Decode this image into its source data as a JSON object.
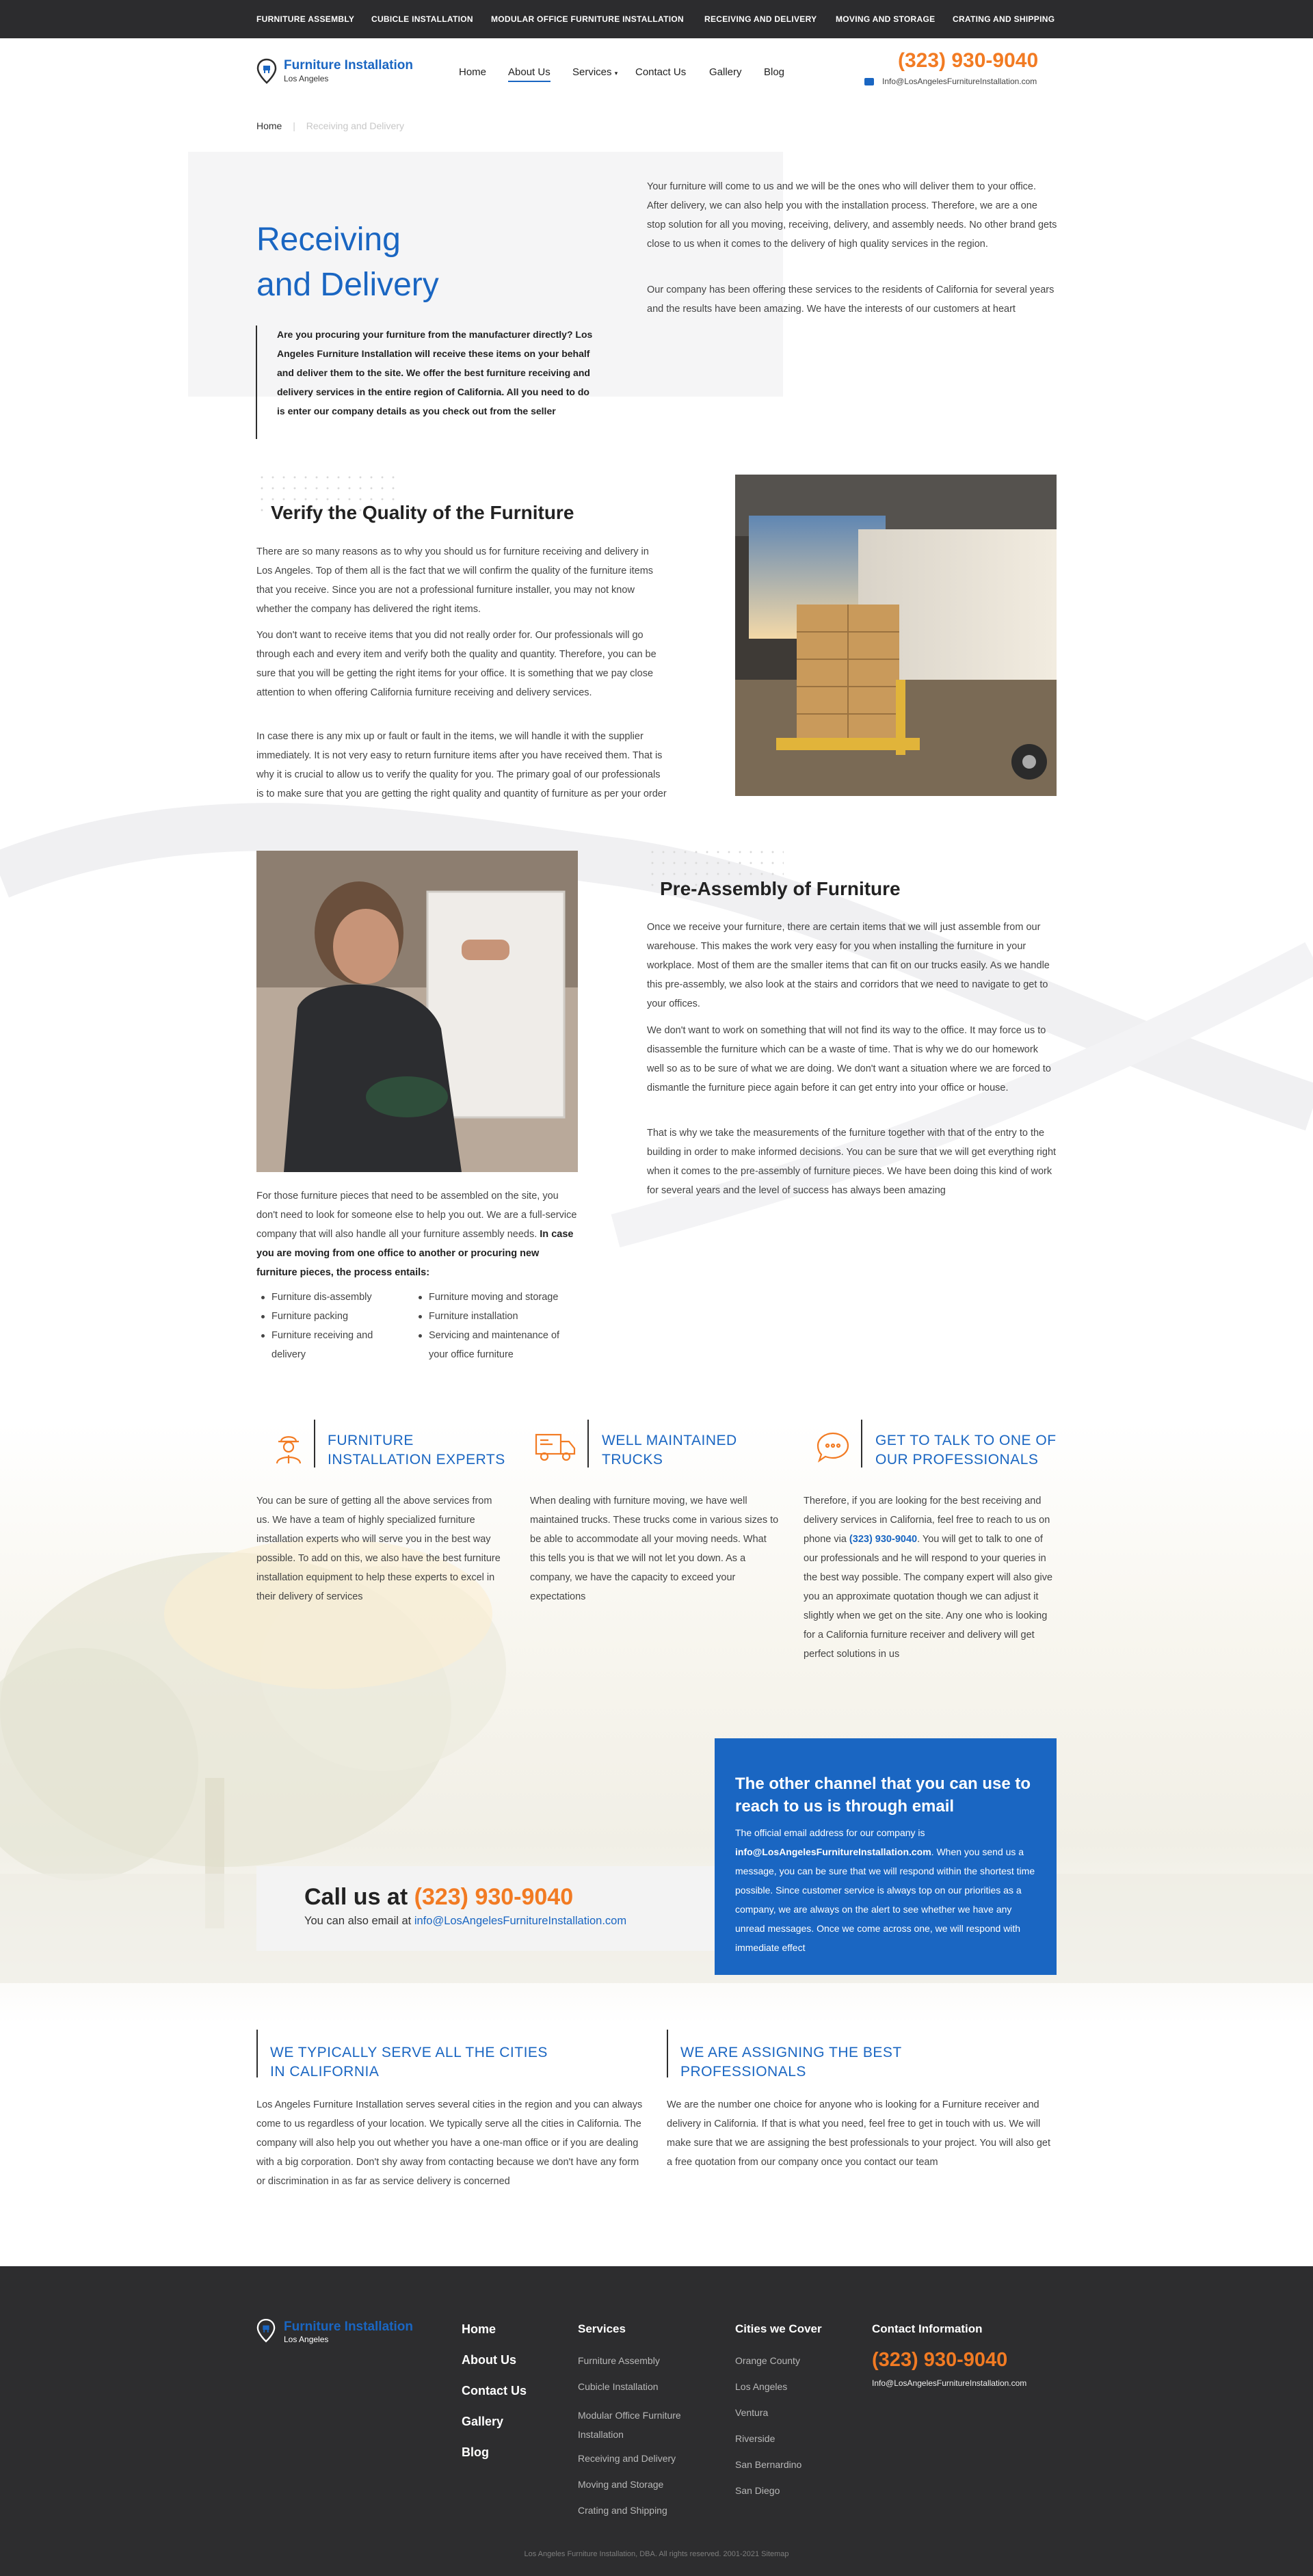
{
  "top_nav": [
    "FURNITURE ASSEMBLY",
    "CUBICLE INSTALLATION",
    "MODULAR OFFICE FURNITURE INSTALLATION",
    "RECEIVING AND DELIVERY",
    "MOVING AND STORAGE",
    "CRATING AND SHIPPING"
  ],
  "logo": {
    "name": "Furniture Installation",
    "city": "Los Angeles"
  },
  "main_nav": [
    "Home",
    "About Us",
    "Services",
    "Contact Us",
    "Gallery",
    "Blog"
  ],
  "header": {
    "phone": "(323) 930-9040",
    "email": "Info@LosAngelesFurnitureInstallation.com"
  },
  "breadcrumb": {
    "home": "Home",
    "separator": "|",
    "current": "Receiving and Delivery"
  },
  "hero": {
    "title_line1": "Receiving",
    "title_line2": "and Delivery",
    "quote": "Are you procuring your furniture from the manufacturer directly? Los Angeles Furniture Installation will receive these items on your behalf and deliver them to the site. We offer the best furniture receiving and delivery services in the entire region of California. All you need to do is enter our company details as you check out from the seller",
    "p1": "Your furniture will come to us and we will be the ones who will deliver them to your office. After delivery, we can also help you with the installation process. Therefore, we are a one stop solution for all you moving, receiving, delivery, and assembly needs. No other brand gets close to us when it comes to the delivery of high quality services in the region.",
    "p2": "Our company has been offering these services to the residents of California for several years and the results have been amazing. We have the interests of our customers at heart"
  },
  "verify": {
    "title": "Verify the Quality of the Furniture",
    "p1": "There are so many reasons as to why you should us for furniture receiving and delivery in Los Angeles. Top of them all is the fact that we will confirm the quality of the furniture items that you receive. Since you are not a professional furniture installer, you may not know whether the company has delivered the right items.",
    "p2": "You don't want to receive items that you did not really order for. Our professionals will go through each and every item and verify both the quality and quantity. Therefore, you can be sure that you will be getting the right items for your office. It is something that we pay close attention to when offering California furniture receiving and delivery services.",
    "p3": "In case there is any mix up or fault or fault in the items, we will handle it with the supplier immediately. It is not very easy to return furniture items after you have received them. That is why it is crucial to allow us to verify the quality for you. The primary goal of our professionals is to make sure that you are getting the right quality and quantity of furniture as per your order"
  },
  "preassembly": {
    "title": "Pre-Assembly of Furniture",
    "p1": "Once we receive your furniture, there are certain items that we will just assemble from our warehouse. This makes the work very easy for you when installing the furniture in your workplace. Most of them are the smaller items that can fit on our trucks easily. As we handle this pre-assembly, we also look at the stairs and corridors that we need to navigate to get to your offices.",
    "p2": "We don't want to work on something that will not find its way to the office. It may force us to disassemble the furniture which can be a waste of time. That is why we do our homework well so as to be sure of what we are doing. We don't want a situation where we are forced to dismantle the furniture piece again before it can get entry into your office or house.",
    "p3": "That is why we take the measurements of the furniture together with that of the entry to the building in order to make informed decisions. You can be sure that we will get everything right when it comes to the pre-assembly of furniture pieces. We have been doing this kind of work for several years and the level of success has always been amazing",
    "left_p_normal": "For those furniture pieces that need to be assembled on the site, you don't need to look for someone else to help you out. We are a full-service company that will also handle all your furniture assembly needs.",
    "left_p_bold": "In case you are moving from one office to another or procuring new furniture pieces, the process entails:",
    "list_col1": [
      "Furniture dis-assembly",
      "Furniture packing",
      "Furniture receiving and delivery"
    ],
    "list_col2": [
      "Furniture moving and storage",
      "Furniture installation",
      "Servicing and maintenance of your office furniture"
    ]
  },
  "features": [
    {
      "icon": "worker-icon",
      "title": "FURNITURE INSTALLATION EXPERTS",
      "text": "You can be sure of getting all the above services from us. We have a team of highly specialized furniture installation experts who will serve you in the best way possible. To add on this, we also have the best furniture installation equipment to help these experts to excel in their delivery of services"
    },
    {
      "icon": "truck-icon",
      "title": "WELL MAINTAINED TRUCKS",
      "text": "When dealing with furniture moving, we have well maintained trucks. These trucks come in various sizes to be able to accommodate all your moving needs. What this tells you is that we will not let you down. As a company, we have the capacity to exceed your expectations"
    },
    {
      "icon": "chat-icon",
      "title": "GET TO TALK TO ONE OF OUR PROFESSIONALS",
      "text_a": "Therefore, if you are looking for the best receiving and delivery services in California, feel free to reach to us on phone via",
      "text_phone": "(323) 930-9040",
      "text_b": ". You will get to talk to one of our professionals and he will respond to your queries in the best way possible.  The company expert will also give you an approximate quotation though we can adjust it slightly when we get on the site. Any one who is looking for a California furniture receiver and delivery will get perfect solutions in us"
    }
  ],
  "call": {
    "prefix": "Call us at",
    "phone": "(323) 930-9040",
    "email_prefix": "You can also email at",
    "email": "info@LosAngelesFurnitureInstallation.com"
  },
  "channel": {
    "title": "The other channel that you can use to reach to us is through email",
    "text_a": "The official email address for our company is",
    "email": "info@LosAngelesFurnitureInstallation.com",
    "text_b": ". When you send us a message, you can be sure that we will respond within the shortest time possible. Since customer service is always top on our priorities as a company, we are always on the alert to see whether we have any unread messages. Once we come across one, we will respond with immediate effect"
  },
  "bottom": [
    {
      "title_l1": "WE TYPICALLY SERVE ALL THE CITIES",
      "title_l2": "IN CALIFORNIA",
      "text": "Los Angeles Furniture Installation serves several cities in the region and you can always come to us regardless of your location. We typically serve all the cities in California. The company will also help you out whether you have a one-man office or if you are dealing with a big corporation. Don't shy away from contacting because we don't have any form or discrimination in as far as service delivery is concerned"
    },
    {
      "title_l1": "WE ARE ASSIGNING THE BEST",
      "title_l2": "PROFESSIONALS",
      "text": "We are the number one choice for anyone who is looking for a Furniture receiver and delivery in California. If that is what you need, feel free to get in touch with us. We will make sure that we are assigning the best professionals to your project. You will also get a free quotation from our company once you contact our team"
    }
  ],
  "footer": {
    "nav": [
      "Home",
      "About Us",
      "Contact Us",
      "Gallery",
      "Blog"
    ],
    "services_title": "Services",
    "services": [
      "Furniture Assembly",
      "Cubicle Installation",
      "Modular Office Furniture Installation",
      "Receiving and Delivery",
      "Moving and Storage",
      "Crating and Shipping"
    ],
    "cities_title": "Cities we Cover",
    "cities": [
      "Orange County",
      "Los Angeles",
      "Ventura",
      "Riverside",
      "San Bernardino",
      "San Diego"
    ],
    "contact_title": "Contact Information",
    "phone": "(323) 930-9040",
    "email": "Info@LosAngelesFurnitureInstallation.com",
    "copyright": "Los Angeles Furniture Installation, DBA. All rights reserved. 2001-2021 Sitemap"
  },
  "colors": {
    "brand_blue": "#1a66c2",
    "accent_orange": "#f27b23",
    "dark": "#2d2d2f"
  }
}
